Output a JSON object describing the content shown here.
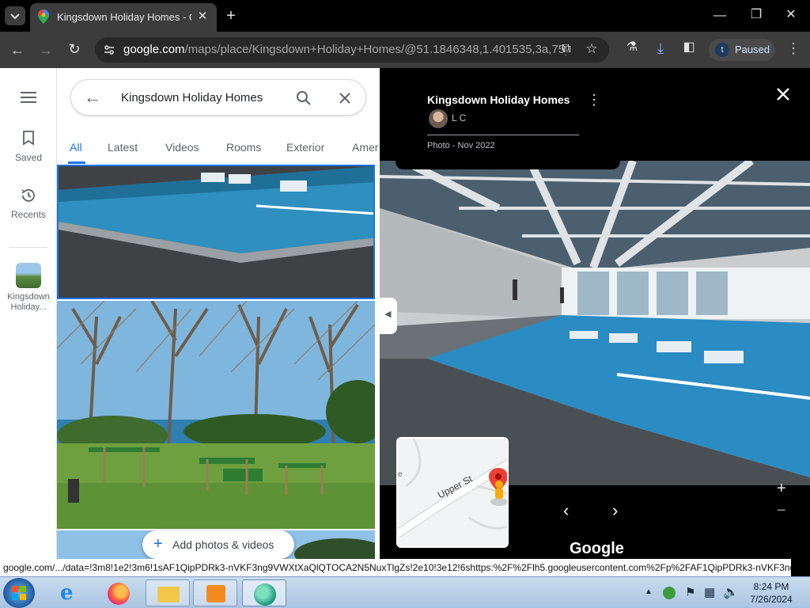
{
  "browser": {
    "tab_title": "Kingsdown Holiday Homes - G",
    "url_host": "google.com",
    "url_path": "/maps/place/Kingsdown+Holiday+Homes/@51.1846348,1.401535,3a,75y...",
    "profile_initial": "t",
    "profile_status": "Paused"
  },
  "rail": {
    "saved_label": "Saved",
    "recents_label": "Recents",
    "place_label_1": "Kingsdown",
    "place_label_2": "Holiday..."
  },
  "search": {
    "query": "Kingsdown Holiday Homes"
  },
  "photo_tabs": [
    {
      "label": "All",
      "active": true
    },
    {
      "label": "Latest"
    },
    {
      "label": "Videos"
    },
    {
      "label": "Rooms"
    },
    {
      "label": "Exterior"
    },
    {
      "label": "Amer"
    }
  ],
  "add_photos_label": "Add photos & videos",
  "viewer": {
    "title": "Kingsdown Holiday Homes",
    "author": "L C",
    "photo_date": "Photo - Nov 2022",
    "minimap_street": "Upper St",
    "minimap_edge_char": "e",
    "brand": "Google"
  },
  "status_url": "google.com/.../data=!3m8!1e2!3m6!1sAF1QipPDRk3-nVKF3ng9VWXtXaQlQTOCA2N5NuxTlgZs!2e10!3e12!6shttps:%2F%2Flh5.googleusercontent.com%2Fp%2FAF1QipPDRk3-nVKF3ng...",
  "taskbar": {
    "time": "8:24 PM",
    "date": "7/26/2024"
  },
  "colors": {
    "accent_blue": "#1a73e8",
    "chrome_dark": "#3c3c3c",
    "pin_red": "#ea4335"
  }
}
